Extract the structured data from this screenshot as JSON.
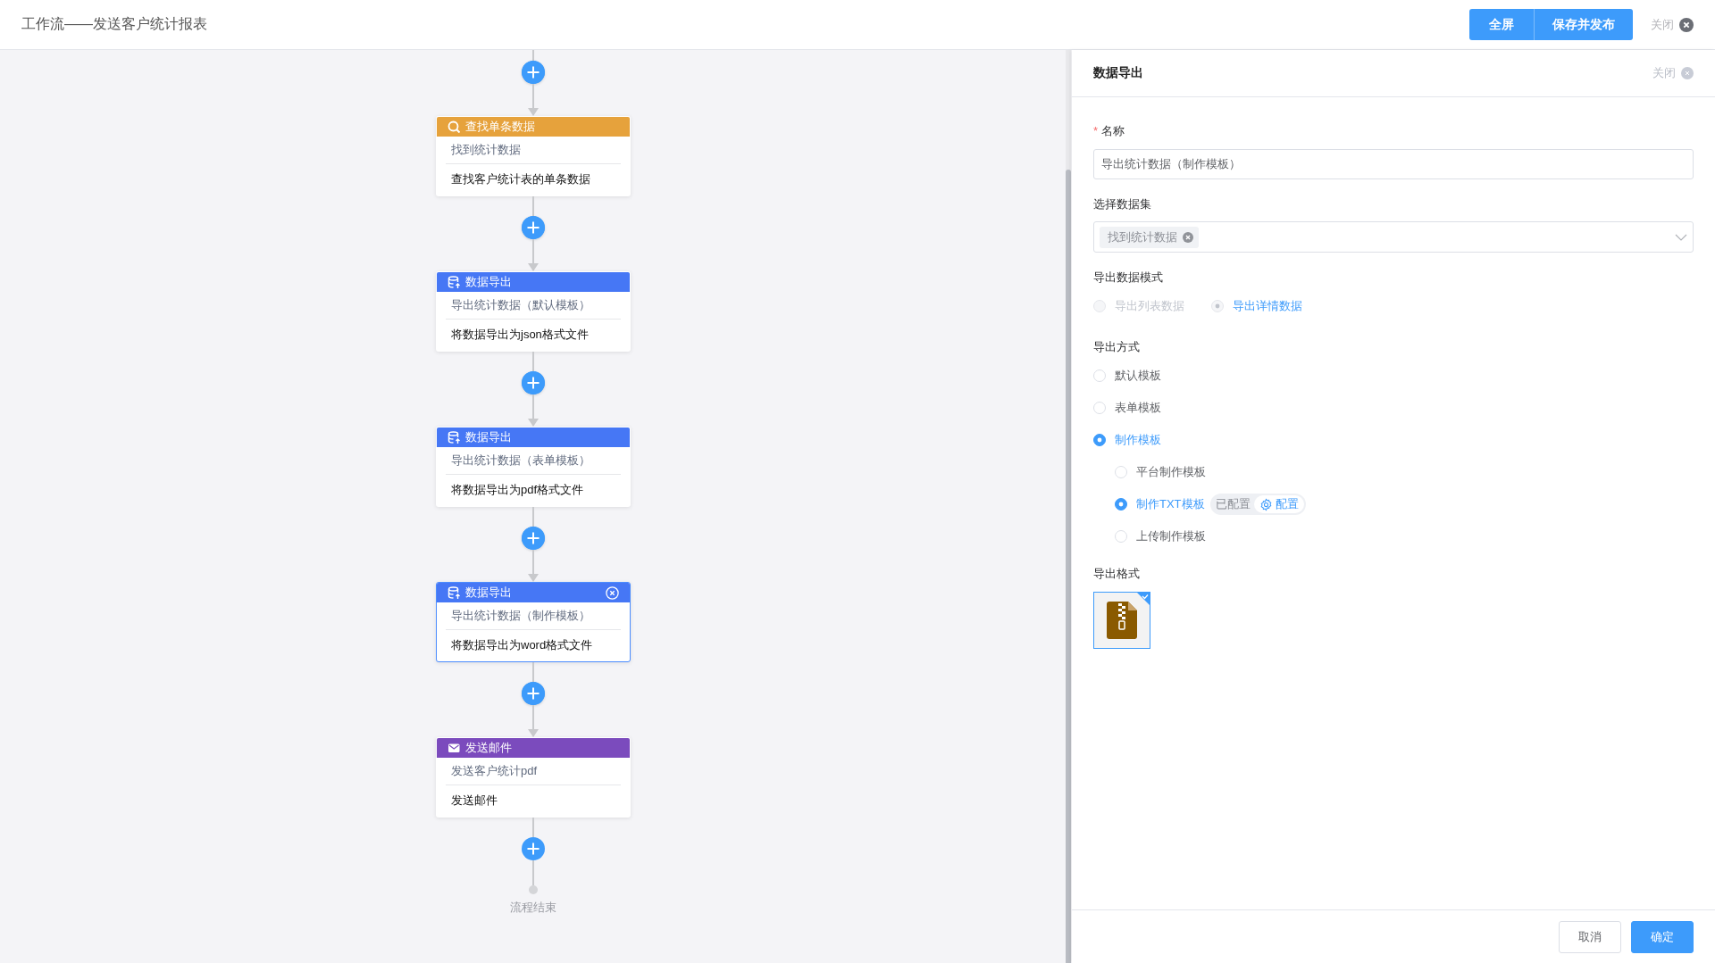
{
  "window": {
    "title": "工作流——发送客户统计报表"
  },
  "toolbar": {
    "buttons": [
      {
        "label": "全屏"
      },
      {
        "label": "保存并发布"
      }
    ],
    "close": "关闭"
  },
  "flow": {
    "nodes": [
      {
        "kind": "find",
        "type": "查找单条数据",
        "name": "找到统计数据",
        "description": "查找客户统计表的单条数据",
        "selected": false
      },
      {
        "kind": "export",
        "type": "数据导出",
        "name": "导出统计数据（默认模板）",
        "description": "将数据导出为json格式文件",
        "selected": false
      },
      {
        "kind": "export",
        "type": "数据导出",
        "name": "导出统计数据（表单模板）",
        "description": "将数据导出为pdf格式文件",
        "selected": false
      },
      {
        "kind": "export",
        "type": "数据导出",
        "name": "导出统计数据（制作模板）",
        "description": "将数据导出为word格式文件",
        "selected": true
      },
      {
        "kind": "mail",
        "type": "发送邮件",
        "name": "发送客户统计pdf",
        "description": "发送邮件",
        "selected": false
      }
    ],
    "end": "流程结束"
  },
  "panel": {
    "title": "数据导出",
    "close": "关闭",
    "name_field": {
      "required_mark": "*",
      "label": "名称",
      "value": "导出统计数据（制作模板）"
    },
    "dataset": {
      "label": "选择数据集",
      "tags": [
        "找到统计数据"
      ]
    },
    "mode": {
      "label": "导出数据模式",
      "disabled": true,
      "options": [
        {
          "label": "导出列表数据",
          "selected": false
        },
        {
          "label": "导出详情数据",
          "selected": true
        }
      ]
    },
    "method": {
      "label": "导出方式",
      "options": [
        {
          "label": "默认模板",
          "selected": false
        },
        {
          "label": "表单模板",
          "selected": false
        },
        {
          "label": "制作模板",
          "selected": true,
          "children": [
            {
              "label": "平台制作模板",
              "selected": false
            },
            {
              "label": "制作TXT模板",
              "selected": true,
              "status": "已配置",
              "action": "配置"
            },
            {
              "label": "上传制作模板",
              "selected": false
            }
          ]
        }
      ]
    },
    "format": {
      "label": "导出格式",
      "options": [
        {
          "kind": "zip",
          "selected": true
        }
      ]
    },
    "buttons": [
      {
        "label": "取消",
        "primary": false
      },
      {
        "label": "确定",
        "primary": true
      }
    ]
  }
}
